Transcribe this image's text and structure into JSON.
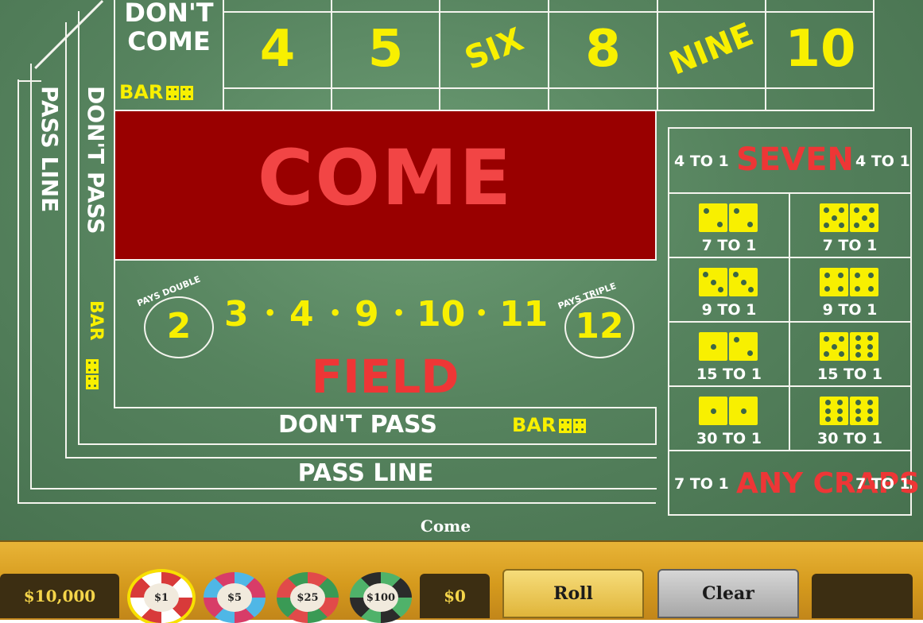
{
  "table": {
    "dont_come_line1": "DON'T",
    "dont_come_line2": "COME",
    "bar": "BAR",
    "points": [
      "4",
      "5",
      "SIX",
      "8",
      "NINE",
      "10"
    ],
    "come": "COME",
    "pass_line_side": "PASS LINE",
    "dont_pass_side": "DON'T PASS",
    "field": {
      "pays_double": "PAYS DOUBLE",
      "double_number": "2",
      "pays_triple": "PAYS TRIPLE",
      "triple_number": "12",
      "numbers": [
        "3",
        "4",
        "9",
        "10",
        "11"
      ],
      "label": "FIELD"
    },
    "dont_pass_bottom": "DON'T PASS",
    "pass_line_bottom": "PASS LINE",
    "status": "Come"
  },
  "proposition": {
    "seven": {
      "left_odds": "4 TO 1",
      "label": "SEVEN",
      "right_odds": "4 TO 1"
    },
    "hardways": [
      {
        "odds": "7 TO 1",
        "dice": [
          2,
          2
        ]
      },
      {
        "odds": "7 TO 1",
        "dice": [
          5,
          5
        ]
      },
      {
        "odds": "9 TO 1",
        "dice": [
          3,
          3
        ]
      },
      {
        "odds": "9 TO 1",
        "dice": [
          4,
          4
        ]
      },
      {
        "odds": "15 TO 1",
        "dice": [
          1,
          2
        ]
      },
      {
        "odds": "15 TO 1",
        "dice": [
          5,
          6
        ]
      },
      {
        "odds": "30 TO 1",
        "dice": [
          1,
          1
        ]
      },
      {
        "odds": "30 TO 1",
        "dice": [
          6,
          6
        ]
      }
    ],
    "any_craps": {
      "left_odds": "7 TO 1",
      "label": "ANY CRAPS",
      "right_odds": "7 TO 1"
    }
  },
  "footer": {
    "balance": "$10,000",
    "chips": [
      {
        "label": "$1",
        "selected": true,
        "color": "#ffffff",
        "stripe": "#d83a3a"
      },
      {
        "label": "$5",
        "selected": false,
        "color": "#d83c68",
        "stripe": "#4fb7e6"
      },
      {
        "label": "$25",
        "selected": false,
        "color": "#3a9a55",
        "stripe": "#e14a4a"
      },
      {
        "label": "$100",
        "selected": false,
        "color": "#2b2b2b",
        "stripe": "#4fb26a"
      }
    ],
    "bet_total": "$0",
    "roll": "Roll",
    "clear": "Clear",
    "extra": ""
  },
  "colors": {
    "felt": "#56835e",
    "come_box": "#990000",
    "yellow": "#f8f000",
    "red_text": "#ee3636",
    "gold": "#d59a1d",
    "panel": "#3c2e12"
  }
}
